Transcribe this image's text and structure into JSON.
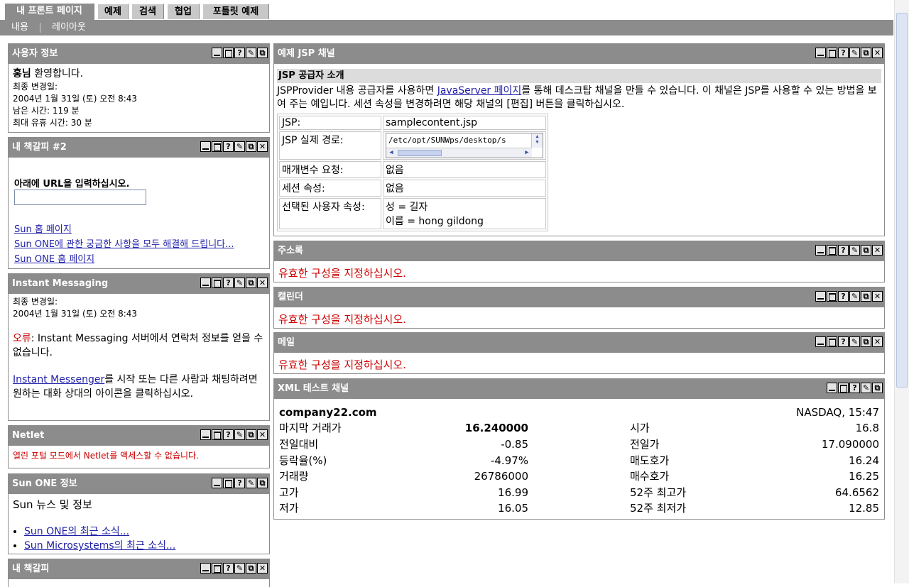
{
  "tabs": [
    "내 프론트 페이지",
    "예제",
    "검색",
    "협업",
    "포틀릿 예제"
  ],
  "subnav": [
    "내용",
    "레이아웃"
  ],
  "user_info": {
    "title": "사용자 정보",
    "welcome_name": "홍님",
    "welcome_text": "환영합니다.",
    "modified_label": "최종 변경일:",
    "modified_date": "2004년 1월 31일 (토) 오전 8:43",
    "time_left": "남은 시간: 119 분",
    "max_idle": "최대 유휴 시간: 30 분"
  },
  "bookmark2": {
    "title": "내 책갈피 #2",
    "prompt": "아래에 URL을 입력하십시오.",
    "url_value": "",
    "links": [
      "Sun 홈 페이지",
      "Sun ONE에 관한 궁금한 사항을 모두 해결해 드립니다...",
      "Sun ONE 홈 페이지"
    ]
  },
  "im": {
    "title": "Instant Messaging",
    "modified_label": "최종 변경일:",
    "modified_date": "2004년 1월 31일 (토) 오전 8:43",
    "error_label": "오류",
    "error_text": ": Instant Messaging 서버에서 연락처 정보를 얻을 수 없습니다.",
    "link": "Instant Messenger",
    "after_link": "를 시작 또는 다른 사람과 채팅하려면 원하는 대화 상대의 아이콘을 클릭하십시오."
  },
  "netlet": {
    "title": "Netlet",
    "error": "열린 포털 모드에서 Netlet를 액세스할 수 없습니다."
  },
  "sunone": {
    "title": "Sun ONE 정보",
    "heading": "Sun 뉴스 및 정보",
    "links": [
      "Sun ONE의 최근 소식...",
      "Sun Microsystems의 최근 소식..."
    ]
  },
  "bookmark": {
    "title": "내 책갈피"
  },
  "jsp": {
    "title": "예제 JSP 채널",
    "subtitle": "JSP 공급자 소개",
    "intro_pre": "JSPProvider 내용 공급자를 사용하면 ",
    "intro_link": "JavaServer 페이지",
    "intro_post": "를 통해 데스크탑 채널을 만들 수 있습니다. 이 채널은 JSP를 사용할 수 있는 방법을 보여 주는 예입니다. 세션 속성을 변경하려면 해당 채널의 [편집] 버튼을 클릭하십시오.",
    "rows": [
      {
        "label": "JSP:",
        "value": "samplecontent.jsp"
      },
      {
        "label": "JSP 실제 경로:",
        "value": "/etc/opt/SUNWps/desktop/s"
      },
      {
        "label": "매개변수 요청:",
        "value": "없음"
      },
      {
        "label": "세션 속성:",
        "value": "없음"
      },
      {
        "label": "선택된 사용자 속성:",
        "value": "성 = 길자",
        "value2": "이름 = hong gildong"
      }
    ]
  },
  "address": {
    "title": "주소록",
    "error": "유효한 구성을 지정하십시오."
  },
  "calendar": {
    "title": "캘린더",
    "error": "유효한 구성을 지정하십시오."
  },
  "mail": {
    "title": "메일",
    "error": "유효한 구성을 지정하십시오."
  },
  "xml": {
    "title": "XML 테스트 채널",
    "company": "company22.com",
    "exchange": "NASDAQ, 15:47",
    "left": [
      {
        "label": "마지막 거래가",
        "value": "16.240000"
      },
      {
        "label": "전일대비",
        "value": "-0.85"
      },
      {
        "label": "등락율(%)",
        "value": "-4.97%"
      },
      {
        "label": "거래량",
        "value": "26786000"
      },
      {
        "label": "고가",
        "value": "16.99"
      },
      {
        "label": "저가",
        "value": "16.05"
      }
    ],
    "right": [
      {
        "label": "시가",
        "value": "16.8"
      },
      {
        "label": "전일가",
        "value": "17.090000"
      },
      {
        "label": "매도호가",
        "value": "16.24"
      },
      {
        "label": "매수호가",
        "value": "16.25"
      },
      {
        "label": "52주 최고가",
        "value": "64.6562"
      },
      {
        "label": "52주 최저가",
        "value": "12.85"
      }
    ]
  },
  "colors": {
    "header_gray": "#8c8c8c",
    "error_red": "#cc0000",
    "link_blue": "#1f1fa8"
  },
  "icons": [
    "minimize-icon",
    "maximize-icon",
    "help-icon",
    "edit-icon",
    "detach-icon",
    "remove-icon"
  ]
}
